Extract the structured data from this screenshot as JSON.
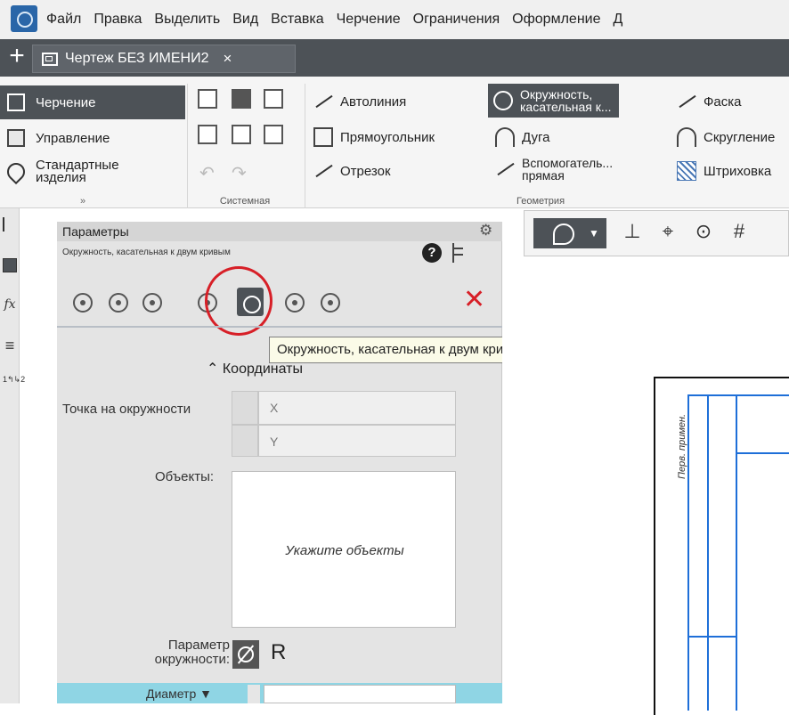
{
  "menubar": {
    "items": [
      "Файл",
      "Правка",
      "Выделить",
      "Вид",
      "Вставка",
      "Черчение",
      "Ограничения",
      "Оформление",
      "Д"
    ]
  },
  "tabbar": {
    "new_tab_label": "+",
    "document_title": "Чертеж БЕЗ ИМЕНИ2",
    "close_label": "×"
  },
  "ribbon": {
    "categories": [
      "Черчение",
      "Управление",
      "Стандартные изделия"
    ],
    "expand_label": "»",
    "system_group_label": "Системная",
    "geometry_group_label": "Геометрия",
    "geometry_buttons": {
      "autoline": "Автолиния",
      "rectangle": "Прямоугольник",
      "segment": "Отрезок",
      "circle_tangent_line1": "Окружность,",
      "circle_tangent_line2": "касательная к...",
      "arc": "Дуга",
      "aux_line1": "Вспомогатель...",
      "aux_line2": "прямая",
      "chamfer": "Фаска",
      "fillet": "Скругление",
      "hatch": "Штриховка"
    }
  },
  "left_toolbar": {
    "items": [
      "tree-icon",
      "parameters-icon",
      "formula-icon",
      "layers-icon",
      "numbering-icon"
    ],
    "fx_label": "fx",
    "numbering_label": "1↰↳2"
  },
  "param_panel": {
    "title": "Параметры",
    "command_title": "Окружность, касательная к двум кривым",
    "help_label": "?",
    "coords_header": "Координаты",
    "point_label": "Точка на окружности",
    "x_label": "X",
    "y_label": "Y",
    "objects_label": "Объекты:",
    "objects_placeholder": "Укажите объекты",
    "circle_param_label": "Параметр окружности:",
    "radius_label": "R",
    "diameter_label": "Диаметр ▼"
  },
  "tooltip": {
    "text": "Окружность, касательная к двум кривым"
  },
  "drawing": {
    "stamp_text": "Перв. примен."
  },
  "colors": {
    "accent_dark": "#4d5257",
    "highlight_circle": "#d71f27",
    "drawing_lines": "#1e6fd8",
    "input_highlight": "#8fd5e4"
  }
}
